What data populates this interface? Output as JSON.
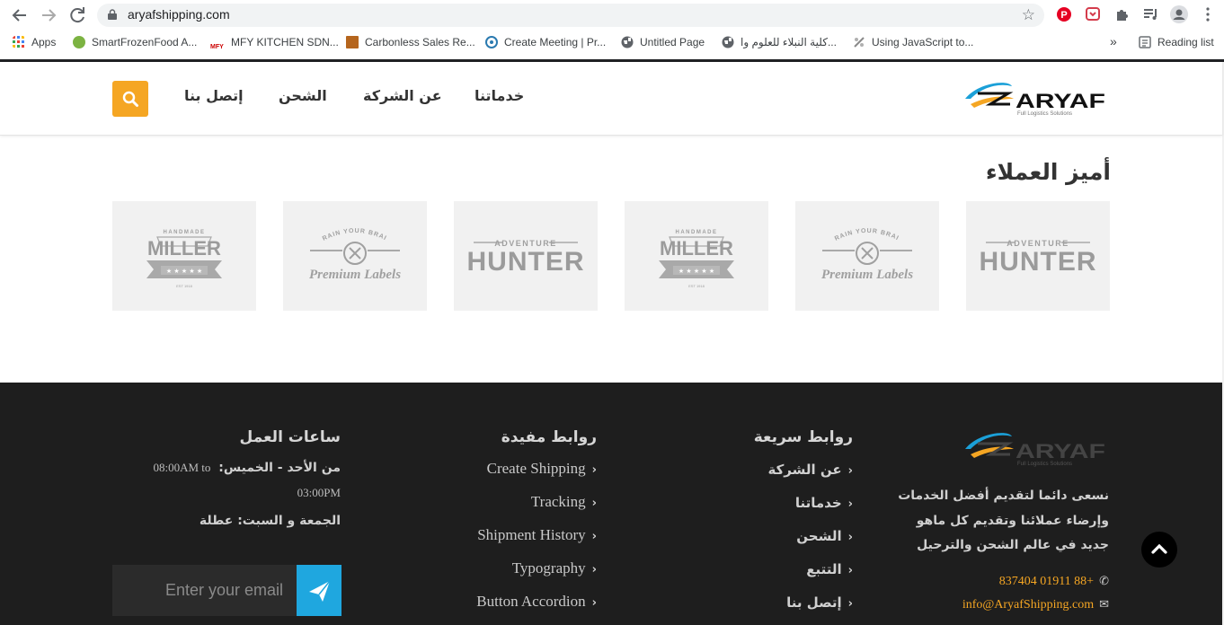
{
  "browser": {
    "url": "aryafshipping.com",
    "bookmarks": [
      {
        "label": "Apps",
        "icon": "apps-grid-icon"
      },
      {
        "label": "SmartFrozenFood A...",
        "icon": "smartfrozen-favicon"
      },
      {
        "label": "MFY KITCHEN SDN...",
        "icon": "mfy-favicon"
      },
      {
        "label": "Carbonless Sales Re...",
        "icon": "carbonless-favicon"
      },
      {
        "label": "Create Meeting | Pr...",
        "icon": "meeting-favicon"
      },
      {
        "label": "Untitled Page",
        "icon": "globe-icon"
      },
      {
        "label": "كلية النبلاء للعلوم وا...",
        "icon": "globe-icon"
      },
      {
        "label": "Using JavaScript to...",
        "icon": "js-favicon"
      }
    ],
    "more_bookmarks": "»",
    "reading_list": "Reading list"
  },
  "header": {
    "nav": [
      "خدماتنا",
      "عن الشركة",
      "الشحن",
      "إتصل بنا"
    ],
    "logo_text": "ARYAF",
    "logo_tagline": "Full Logistics Solutions"
  },
  "clients": {
    "title": "أميز العملاء",
    "logos": [
      {
        "top": "ADVENTURE",
        "main": "HUNTER",
        "kind": "hunter"
      },
      {
        "top": "TRAIN YOUR BRAIN",
        "main": "Premium Labels",
        "kind": "premium"
      },
      {
        "top": "HANDMADE",
        "main": "MILLER",
        "sub": "EST 1918",
        "kind": "miller"
      },
      {
        "top": "ADVENTURE",
        "main": "HUNTER",
        "kind": "hunter"
      },
      {
        "top": "TRAIN YOUR BRAIN",
        "main": "Premium Labels",
        "kind": "premium"
      },
      {
        "top": "HANDMADE",
        "main": "MILLER",
        "sub": "EST 1918",
        "kind": "miller"
      }
    ]
  },
  "footer": {
    "about": {
      "logo_text": "ARYAF",
      "logo_tagline": "Full Logistics Solutions",
      "lines": [
        "نسعى دائما لتقديم أفضل الخدمات",
        "وإرضاء عملائنا وتقديم كل ماهو",
        "جديد في عالم الشحن والترحيل"
      ],
      "phone": "837404 01911 88+",
      "email": "info@AryafShipping.com"
    },
    "quick_links": {
      "title": "روابط سريعة",
      "items": [
        "عن الشركة",
        "خدماتنا",
        "الشحن",
        "التتبع",
        "إتصل بنا"
      ]
    },
    "useful_links": {
      "title": "روابط مفيدة",
      "items": [
        "Create Shipping",
        "Tracking",
        "Shipment History",
        "Typography",
        "Button Accordion"
      ]
    },
    "hours": {
      "title": "ساعات العمل",
      "weekdays_label": "من الأحد - الخميس:",
      "weekdays_time_start": "08:00AM",
      "weekdays_to": "to",
      "weekdays_time_end": "03:00PM",
      "weekend_label": "الجمعة و السبت:",
      "weekend_value": "عطلة"
    },
    "newsletter": {
      "placeholder": "Enter your email"
    }
  },
  "colors": {
    "accent_orange": "#f5a623",
    "accent_blue": "#1fa7df",
    "footer_bg": "#1e1e1e",
    "logo_card_bg": "#f1f1f1"
  }
}
